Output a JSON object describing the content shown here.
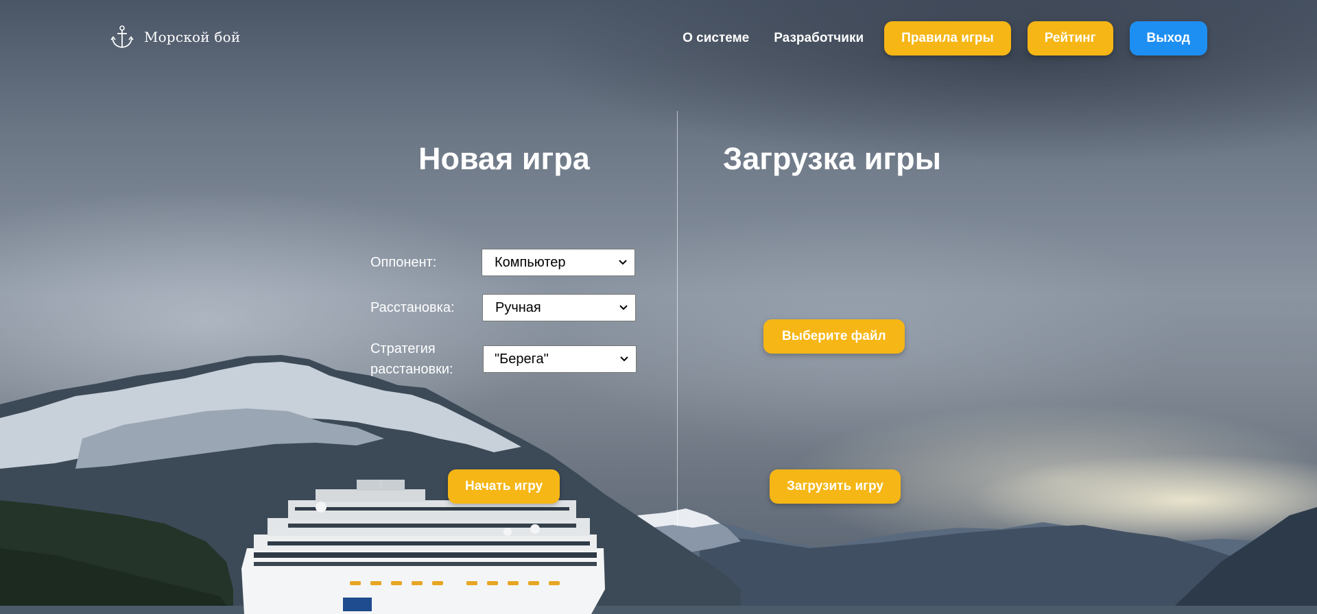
{
  "app": {
    "name": "Морской бой",
    "logo_icon": "anchor-icon"
  },
  "nav": {
    "about": "О системе",
    "developers": "Разработчики",
    "rules": "Правила игры",
    "rating": "Рейтинг",
    "logout": "Выход"
  },
  "new_game": {
    "title": "Новая игра",
    "opponent_label": "Оппонент:",
    "opponent_value": "Компьютер",
    "placement_label": "Расстановка:",
    "placement_value": "Ручная",
    "strategy_label_line1": "Стратегия",
    "strategy_label_line2": "расстановки:",
    "strategy_value": "\"Берега\"",
    "start_button": "Начать игру"
  },
  "load_game": {
    "title": "Загрузка игры",
    "choose_file_button": "Выберите файл",
    "load_button": "Загрузить игру"
  },
  "colors": {
    "accent_yellow": "#f6b615",
    "accent_blue": "#1e8ff2"
  }
}
